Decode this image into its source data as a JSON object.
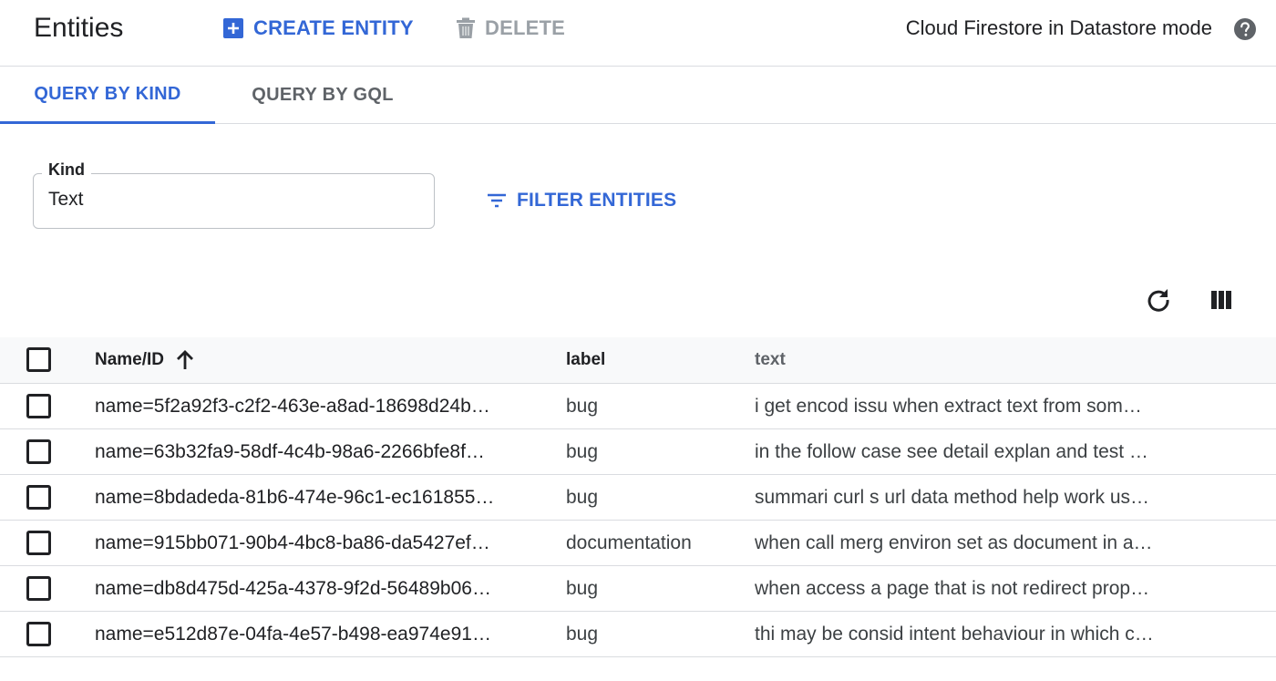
{
  "header": {
    "title": "Entities",
    "create_label": "CREATE ENTITY",
    "delete_label": "DELETE",
    "mode_label": "Cloud Firestore in Datastore mode"
  },
  "tabs": [
    {
      "label": "QUERY BY KIND",
      "active": true
    },
    {
      "label": "QUERY BY GQL",
      "active": false
    }
  ],
  "query": {
    "kind_label": "Kind",
    "kind_value": "Text",
    "filter_label": "FILTER ENTITIES"
  },
  "table": {
    "columns": {
      "name": "Name/ID",
      "label": "label",
      "text": "text"
    },
    "rows": [
      {
        "name": "name=5f2a92f3-c2f2-463e-a8ad-18698d24b…",
        "label": "bug",
        "text": "i get encod issu when extract text from som…"
      },
      {
        "name": "name=63b32fa9-58df-4c4b-98a6-2266bfe8f…",
        "label": "bug",
        "text": "in the follow case see detail explan and test …"
      },
      {
        "name": "name=8bdadeda-81b6-474e-96c1-ec161855…",
        "label": "bug",
        "text": "summari curl s url data method help work us…"
      },
      {
        "name": "name=915bb071-90b4-4bc8-ba86-da5427ef…",
        "label": "documentation",
        "text": "when call merg environ set as document in a…"
      },
      {
        "name": "name=db8d475d-425a-4378-9f2d-56489b06…",
        "label": "bug",
        "text": "when access a page that is not redirect prop…"
      },
      {
        "name": "name=e512d87e-04fa-4e57-b498-ea974e91…",
        "label": "bug",
        "text": "thi may be consid intent behaviour in which c…"
      }
    ]
  },
  "colors": {
    "accent": "#3367d6",
    "disabled": "#9aa0a6",
    "divider": "#dadce0",
    "header_bg": "#f8f9fa"
  },
  "icons": {
    "create": "add-box-icon",
    "delete": "trash-icon",
    "help": "help-circle-icon",
    "filter": "filter-list-icon",
    "refresh": "refresh-icon",
    "columns": "view-columns-icon",
    "sort": "arrow-up-icon"
  }
}
